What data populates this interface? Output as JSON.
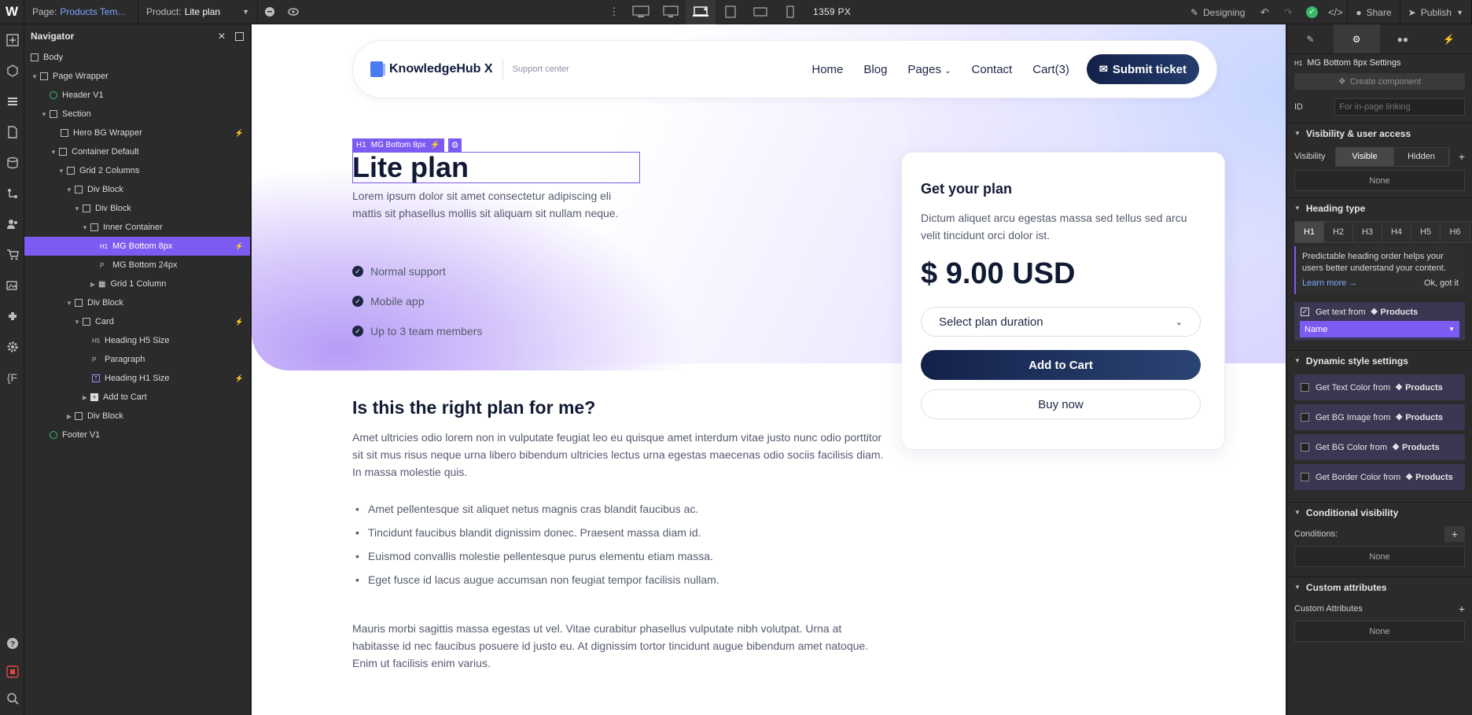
{
  "topbar": {
    "page_label": "Page:",
    "page_value": "Products Tem...",
    "product_label": "Product:",
    "product_value": "Lite plan",
    "width_readout": "1359 PX",
    "mode": "Designing",
    "share": "Share",
    "publish": "Publish"
  },
  "navigator": {
    "title": "Navigator",
    "items": [
      {
        "label": "Body"
      },
      {
        "label": "Page Wrapper"
      },
      {
        "label": "Header V1"
      },
      {
        "label": "Section"
      },
      {
        "label": "Hero BG Wrapper"
      },
      {
        "label": "Container Default"
      },
      {
        "label": "Grid 2 Columns"
      },
      {
        "label": "Div Block"
      },
      {
        "label": "Div Block"
      },
      {
        "label": "Inner Container"
      },
      {
        "label": "MG Bottom 8px",
        "tag": "H1"
      },
      {
        "label": "MG Bottom 24px",
        "tag": "P"
      },
      {
        "label": "Grid 1 Column"
      },
      {
        "label": "Div Block"
      },
      {
        "label": "Card"
      },
      {
        "label": "Heading H5 Size",
        "tag": "H5"
      },
      {
        "label": "Paragraph",
        "tag": "P"
      },
      {
        "label": "Heading H1 Size"
      },
      {
        "label": "Add to Cart"
      },
      {
        "label": "Div Block"
      },
      {
        "label": "Footer V1"
      }
    ]
  },
  "canvas": {
    "brand": "KnowledgeHub X",
    "brand_sub": "Support center",
    "nav": {
      "home": "Home",
      "blog": "Blog",
      "pages": "Pages",
      "contact": "Contact",
      "cart": "Cart(3)",
      "ticket": "Submit ticket"
    },
    "selection_label": "MG Bottom 8px",
    "selection_tag": "H1",
    "heading": "Lite plan",
    "intro": "Lorem ipsum dolor sit amet consectetur adipiscing eli mattis sit phasellus mollis sit aliquam sit nullam neque.",
    "features": [
      "Normal support",
      "Mobile app",
      "Up to 3 team members"
    ],
    "card": {
      "title": "Get your plan",
      "text": "Dictum aliquet arcu egestas massa sed tellus sed arcu velit tincidunt orci dolor ist.",
      "price": "$ 9.00 USD",
      "select": "Select plan duration",
      "add": "Add to Cart",
      "buy": "Buy now"
    },
    "section_title": "Is this the right plan for me?",
    "section_p1": "Amet ultricies odio lorem non in vulputate feugiat leo eu quisque amet interdum vitae justo nunc odio porttitor sit sit mus risus neque urna libero bibendum ultricies lectus urna egestas maecenas odio sociis facilisis diam. In massa molestie quis.",
    "bullets": [
      "Amet pellentesque sit aliquet netus magnis cras blandit faucibus ac.",
      "Tincidunt faucibus blandit dignissim donec. Praesent massa diam id.",
      "Euismod convallis molestie pellentesque purus elementu etiam massa.",
      "Eget fusce id lacus augue accumsan non feugiat tempor facilisis nullam."
    ],
    "section_p2": "Mauris morbi sagittis massa egestas ut vel. Vitae curabitur phasellus vulputate nibh volutpat. Urna at habitasse id nec faucibus posuere id justo eu. At dignissim tortor tincidunt augue bibendum amet natoque. Enim ut facilisis enim varius."
  },
  "settings": {
    "title": "MG Bottom 8px Settings",
    "create_component": "Create component",
    "id_label": "ID",
    "id_placeholder": "For in-page linking",
    "visibility_section": "Visibility & user access",
    "visibility_label": "Visibility",
    "visible": "Visible",
    "hidden": "Hidden",
    "none": "None",
    "heading_type_section": "Heading type",
    "heading_levels": [
      "H1",
      "H2",
      "H3",
      "H4",
      "H5",
      "H6"
    ],
    "note": "Predictable heading order helps your users better understand your content.",
    "learn_more": "Learn more →",
    "ok": "Ok, got it",
    "get_text_from": "Get text from",
    "products": "Products",
    "name_field": "Name",
    "dynamic_section": "Dynamic style settings",
    "dynamic": [
      "Get Text Color from",
      "Get BG Image from",
      "Get BG Color from",
      "Get Border Color from"
    ],
    "conditional_section": "Conditional visibility",
    "conditions": "Conditions:",
    "custom_attr_section": "Custom attributes",
    "custom_attr_label": "Custom Attributes"
  }
}
